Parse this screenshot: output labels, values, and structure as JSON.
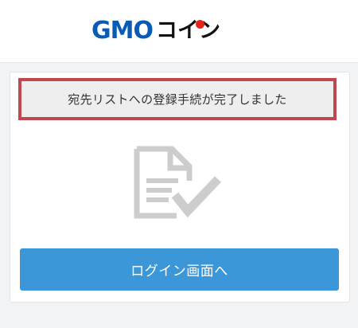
{
  "header": {
    "logo_gmo": "GMO",
    "logo_coin": "コイン"
  },
  "card": {
    "message": "宛先リストへの登録手続が完了しました",
    "icon": "document-check-icon",
    "login_button_label": "ログイン画面へ"
  },
  "colors": {
    "brand_blue": "#0a5bb5",
    "brand_red": "#e1251b",
    "button_blue": "#3b97d8",
    "highlight_border": "#c0474d",
    "icon_gray": "#cdcdcd"
  }
}
